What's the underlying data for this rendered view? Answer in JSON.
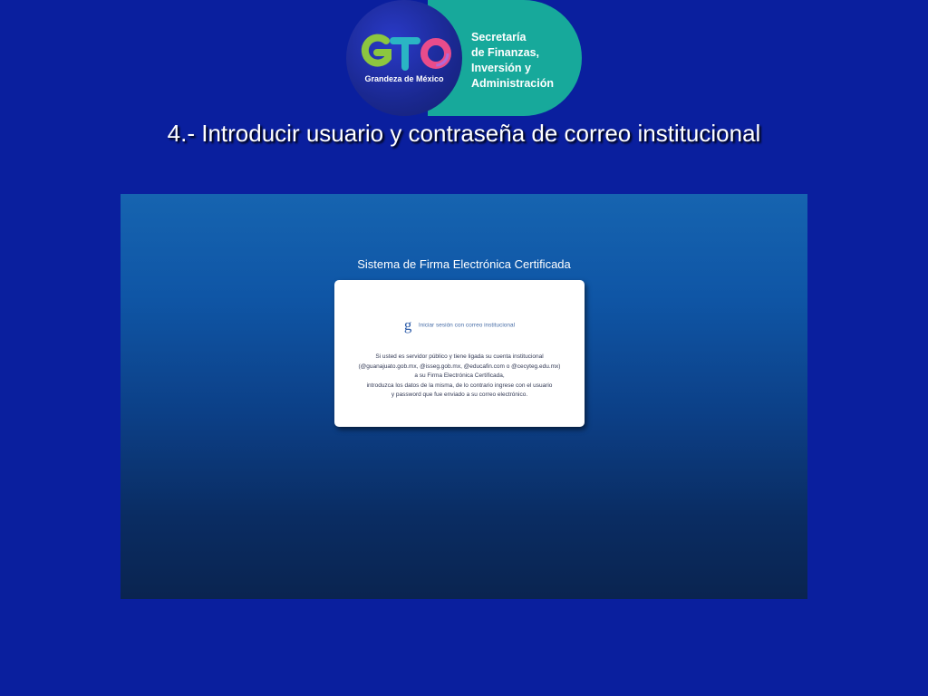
{
  "logo": {
    "mark": "GTO",
    "tagline": "Grandeza de México",
    "org_lines": [
      "Secretaría",
      "de Finanzas,",
      "Inversión y",
      "Administración"
    ],
    "colors": {
      "circle": "#1a2890",
      "pill": "#17a99b",
      "g_green": "#8cc63f",
      "t_teal": "#2ab5c4",
      "o_pink": "#e84c8b"
    }
  },
  "heading": "4.- Introducir usuario y contraseña de correo institucional",
  "screen": {
    "title": "Sistema de Firma Electrónica Certificada",
    "signin": {
      "icon": "g-icon",
      "glyph": "g",
      "label": "Iniciar sesión con correo institucional"
    },
    "notice_lines": [
      "Si usted es servidor público y tiene ligada su cuenta institucional",
      "(@guanajuato.gob.mx, @isseg.gob.mx, @educafin.com o @cecyteg.edu.mx)",
      "a su Firma Electrónica Certificada,",
      "introduzca los datos de la misma, de lo contrario ingrese con el usuario",
      "y password que fue enviado a su correo electrónico."
    ]
  },
  "colors": {
    "background": "#0a1f9e",
    "panel_top": "#1664b0",
    "panel_bottom": "#0a2450"
  }
}
